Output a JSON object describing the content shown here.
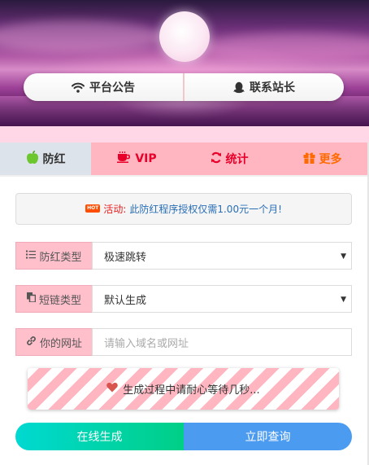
{
  "hero": {
    "announce_label": "平台公告",
    "contact_label": "联系站长"
  },
  "tabs": [
    {
      "label": "防红",
      "icon": "apple-icon",
      "active": true
    },
    {
      "label": "VIP",
      "icon": "coffee-cup-icon"
    },
    {
      "label": "统计",
      "icon": "refresh-icon"
    },
    {
      "label": "更多",
      "icon": "gift-icon"
    }
  ],
  "notice": {
    "badge": "HOT",
    "label": "活动:",
    "text": "此防红程序授权仅需1.00元一个月!"
  },
  "form": {
    "type_label": "防红类型",
    "type_value": "极速跳转",
    "short_label": "短链类型",
    "short_value": "默认生成",
    "url_label": "你的网址",
    "url_placeholder": "请输入域名或网址"
  },
  "progress": {
    "text": "生成过程中请耐心等待几秒..."
  },
  "buttons": {
    "generate": "在线生成",
    "query": "立即查询"
  },
  "colors": {
    "tab_bar": "#ffb6c1",
    "tab_active": "#dde3ea",
    "accent_red": "#e8002a",
    "accent_orange": "#ff6a00",
    "generate_gradient_start": "#00d9d2",
    "generate_gradient_end": "#00cf86",
    "query": "#4b9bf0"
  }
}
